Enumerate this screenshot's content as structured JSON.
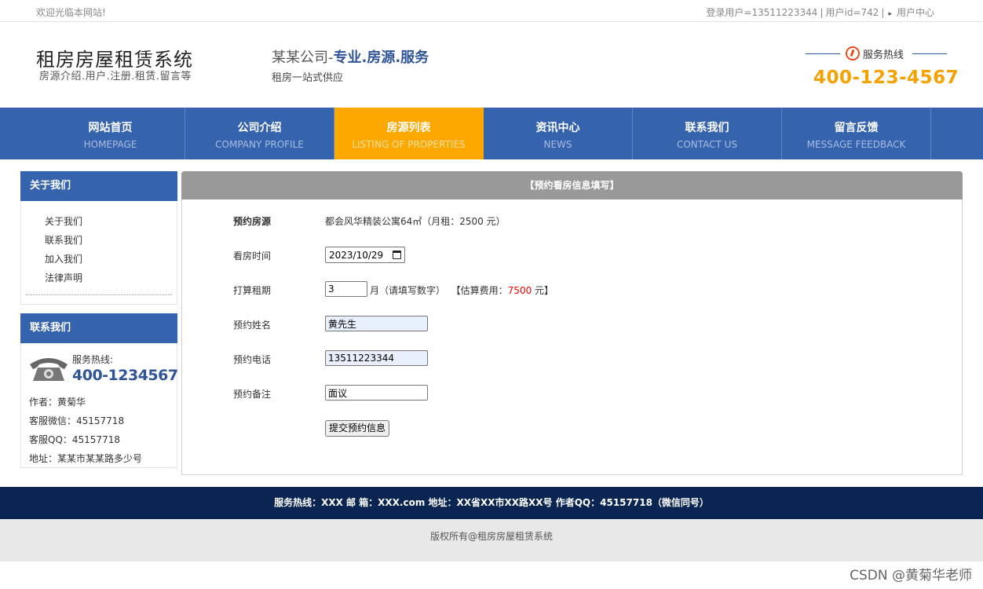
{
  "topbar": {
    "welcome": "欢迎光临本网站!",
    "login_user": "登录用户=13511223344",
    "user_id": "用户id=742",
    "user_center": "用户中心"
  },
  "header": {
    "site_title": "租房房屋租赁系统",
    "site_subtitle": "房源介绍.用户.注册.租赁.留言等",
    "slogan_prefix": "某某公司-",
    "slogan_highlight": "专业.房源.服务",
    "slogan_sub": "租房一站式供应",
    "hotline_label": "服务热线",
    "hotline_number": "400-123-4567"
  },
  "nav": [
    {
      "cn": "网站首页",
      "en": "HOMEPAGE"
    },
    {
      "cn": "公司介绍",
      "en": "COMPANY PROFILE"
    },
    {
      "cn": "房源列表",
      "en": "LISTING OF PROPERTIES"
    },
    {
      "cn": "资讯中心",
      "en": "NEWS"
    },
    {
      "cn": "联系我们",
      "en": "CONTACT US"
    },
    {
      "cn": "留言反馈",
      "en": "MESSAGE FEEDBACK"
    }
  ],
  "nav_active_index": 2,
  "about": {
    "title": "关于我们",
    "items": [
      "关于我们",
      "联系我们",
      "加入我们",
      "法律声明"
    ]
  },
  "contact": {
    "title": "联系我们",
    "service_label": "服务热线:",
    "service_number": "400-1234567",
    "author": "作者：黄菊华",
    "wechat": "客服微信：45157718",
    "qq": "客服QQ：45157718",
    "address": "地址：某某市某某路多少号"
  },
  "form": {
    "title": "【预约看房信息填写】",
    "property_label": "预约房源",
    "property_value": "都会风华精装公寓64㎡（月租：2500 元）",
    "date_label": "看房时间",
    "date_value": "2023/10/29",
    "months_label": "打算租期",
    "months_value": "3",
    "months_hint": "月（请填写数字）",
    "estimate_prefix": "【估算费用：",
    "estimate_value": "7500",
    "estimate_suffix": "元】",
    "name_label": "预约姓名",
    "name_value": "黄先生",
    "phone_label": "预约电话",
    "phone_value": "13511223344",
    "remark_label": "预约备注",
    "remark_value": "面议",
    "submit_label": "提交预约信息"
  },
  "footer": {
    "contact_line": "服务热线：XXX      邮 箱：XXX.com  地址：XX省XX市XX路XX号  作者QQ：45157718（微信同号）",
    "copyright": "版权所有@租房房屋租赁系统"
  },
  "watermark": "CSDN @黄菊华老师",
  "colors": {
    "nav_blue": "#3563ad",
    "nav_active": "#fca800",
    "hotline_orange": "#f5a200",
    "footer_navy": "#0b2553",
    "estimate_red": "#ee0000"
  }
}
